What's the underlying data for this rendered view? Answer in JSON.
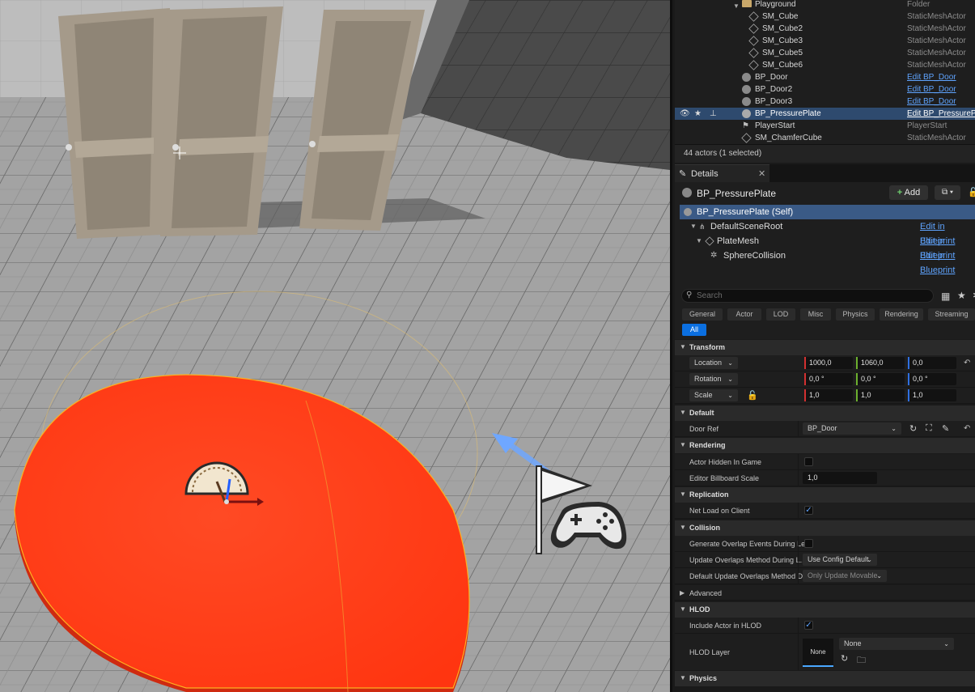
{
  "outliner": {
    "rows": [
      {
        "name": "Playground",
        "type": "Folder"
      },
      {
        "name": "SM_Cube",
        "type": "StaticMeshActor"
      },
      {
        "name": "SM_Cube2",
        "type": "StaticMeshActor"
      },
      {
        "name": "SM_Cube3",
        "type": "StaticMeshActor"
      },
      {
        "name": "SM_Cube5",
        "type": "StaticMeshActor"
      },
      {
        "name": "SM_Cube6",
        "type": "StaticMeshActor"
      },
      {
        "name": "BP_Door",
        "type": "Edit BP_Door"
      },
      {
        "name": "BP_Door2",
        "type": "Edit BP_Door"
      },
      {
        "name": "BP_Door3",
        "type": "Edit BP_Door"
      },
      {
        "name": "BP_PressurePlate",
        "type": "Edit BP_PressurePl"
      },
      {
        "name": "PlayerStart",
        "type": "PlayerStart"
      },
      {
        "name": "SM_ChamferCube",
        "type": "StaticMeshActor"
      }
    ],
    "count": "44 actors (1 selected)"
  },
  "details": {
    "tab_label": "Details",
    "actor_name": "BP_PressurePlate",
    "add_label": "Add",
    "components": [
      {
        "name": "BP_PressurePlate (Self)",
        "edit": ""
      },
      {
        "name": "DefaultSceneRoot",
        "edit": "Edit in Blueprint"
      },
      {
        "name": "PlateMesh",
        "edit": "Edit in Blueprint"
      },
      {
        "name": "SphereCollision",
        "edit": "Edit in Blueprint"
      }
    ],
    "search_placeholder": "Search",
    "filters": [
      "General",
      "Actor",
      "LOD",
      "Misc",
      "Physics",
      "Rendering",
      "Streaming"
    ],
    "filter_all": "All",
    "sections": {
      "transform": "Transform",
      "default": "Default",
      "rendering": "Rendering",
      "replication": "Replication",
      "collision": "Collision",
      "advanced": "Advanced",
      "hlod": "HLOD",
      "physics": "Physics"
    },
    "transform": {
      "location": {
        "label": "Location",
        "x": "1000,0",
        "y": "1060,0",
        "z": "0,0"
      },
      "rotation": {
        "label": "Rotation",
        "x": "0,0 °",
        "y": "0,0 °",
        "z": "0,0 °"
      },
      "scale": {
        "label": "Scale",
        "x": "1,0",
        "y": "1,0",
        "z": "1,0"
      }
    },
    "door_ref": {
      "label": "Door Ref",
      "value": "BP_Door"
    },
    "actor_hidden": {
      "label": "Actor Hidden In Game",
      "checked": false
    },
    "billboard_scale": {
      "label": "Editor Billboard Scale",
      "value": "1,0"
    },
    "net_load": {
      "label": "Net Load on Client",
      "checked": true
    },
    "gen_overlap": {
      "label": "Generate Overlap Events During Le...",
      "checked": false
    },
    "update_overlaps": {
      "label": "Update Overlaps Method During L...",
      "value": "Use Config Default"
    },
    "default_update": {
      "label": "Default Update Overlaps Method D...",
      "value": "Only Update Movable"
    },
    "include_hlod": {
      "label": "Include Actor in HLOD",
      "checked": true
    },
    "hlod_layer": {
      "label": "HLOD Layer",
      "thumb": "None",
      "value": "None"
    }
  },
  "colors": {
    "accent": "#0b6fe0",
    "selection": "#2e4a6e",
    "plate": "#ff3d1f",
    "link": "#5fa4ff"
  }
}
